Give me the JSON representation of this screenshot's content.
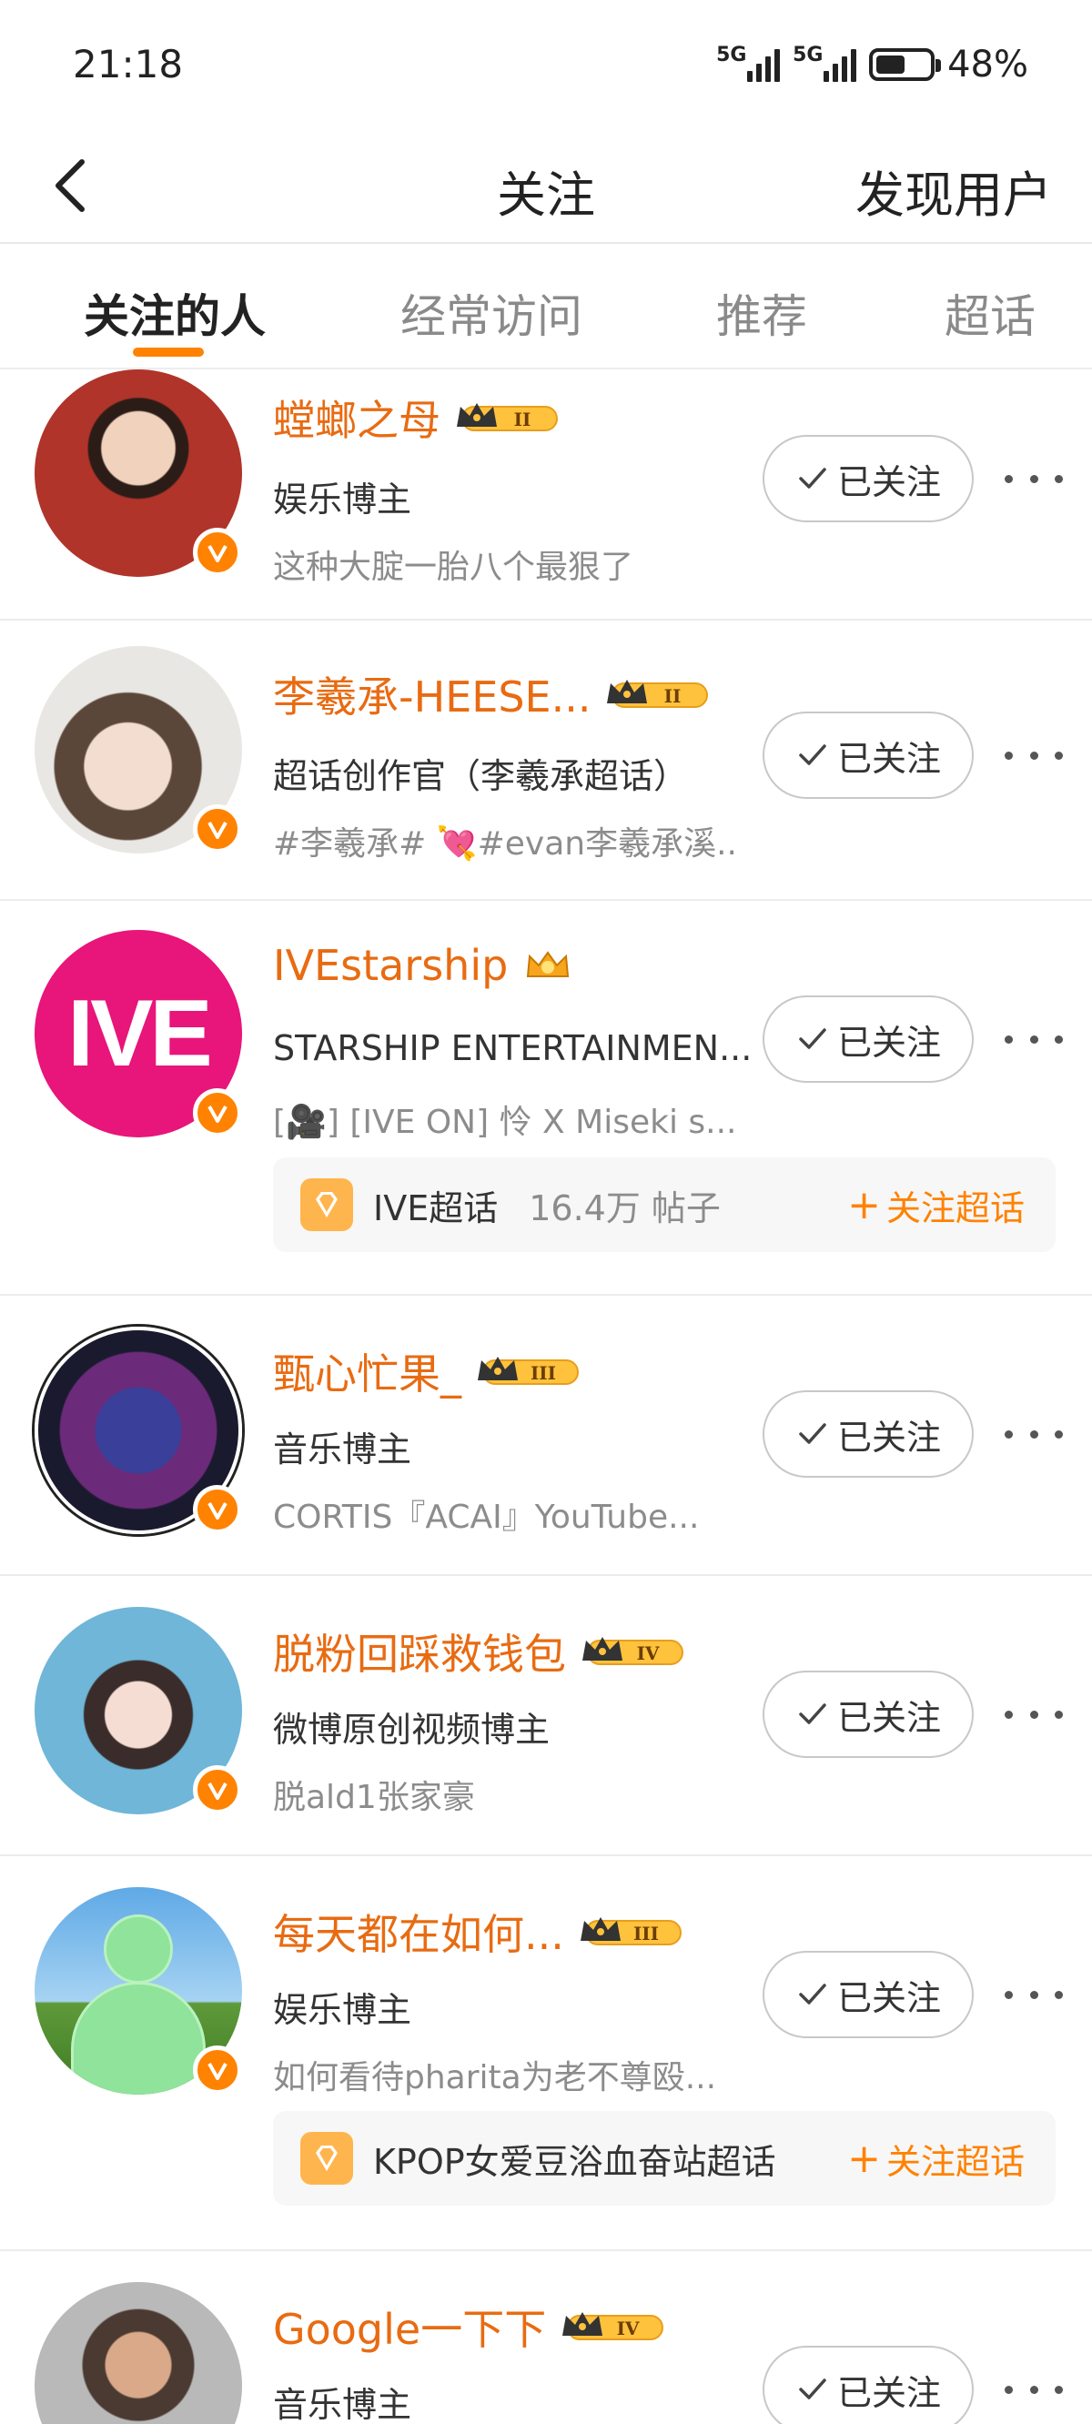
{
  "status": {
    "time": "21:18",
    "signal1": "5G",
    "signal2": "5G",
    "battery": "48%",
    "battery_level": 0.48
  },
  "header": {
    "title": "关注",
    "discover": "发现用户"
  },
  "tabs": [
    {
      "label": "关注的人",
      "active": true
    },
    {
      "label": "经常访问",
      "active": false
    },
    {
      "label": "推荐",
      "active": false
    },
    {
      "label": "超话",
      "active": false
    }
  ],
  "users": [
    {
      "name": "螳螂之母",
      "level": "II",
      "desc": "娱乐博主",
      "post": "这种大腚一胎八个最狠了",
      "follow": "已关注"
    },
    {
      "name": "李羲承-HEESE...",
      "level": "II",
      "desc": "超话创作官（李羲承超话）",
      "post": "#李羲承# 💘#evan李羲承溪...",
      "follow": "已关注"
    },
    {
      "name": "IVEstarship",
      "level": "",
      "desc": "STARSHIP ENTERTAINMEN...",
      "post": "[🎥] [IVE ON] 怜 X Miseki s...",
      "follow": "已关注",
      "topic": {
        "name": "IVE超话",
        "count": "16.4万 帖子",
        "action": "关注超话"
      },
      "avatar_text": "IVE"
    },
    {
      "name": "甄心忙果_",
      "level": "III",
      "desc": "音乐博主",
      "post": "CORTIS『ACAI』YouTube...",
      "follow": "已关注"
    },
    {
      "name": "脱粉回踩救钱包",
      "level": "IV",
      "desc": "微博原创视频博主",
      "post": "脱ald1张家豪",
      "follow": "已关注"
    },
    {
      "name": "每天都在如何...",
      "level": "III",
      "desc": "娱乐博主",
      "post": "如何看待pharita为老不尊殴...",
      "follow": "已关注",
      "topic": {
        "name": "KPOP女爱豆浴血奋站超话",
        "count": "",
        "action": "关注超话"
      }
    },
    {
      "name": "Google一下下",
      "level": "IV",
      "desc": "音乐博主",
      "post": "",
      "follow": "已关注"
    }
  ],
  "colors": {
    "accent": "#ff8200",
    "name": "#e86b12",
    "ive_pink": "#e8157a"
  }
}
